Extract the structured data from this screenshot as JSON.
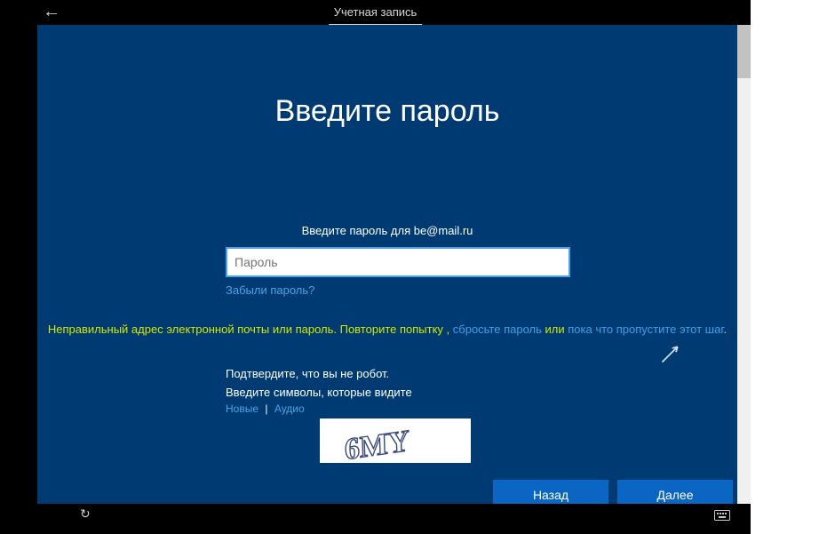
{
  "topbar": {
    "tab_label": "Учетная запись"
  },
  "headline": "Введите пароль",
  "instruction": "Введите пароль для be@mail.ru",
  "password_placeholder": "Пароль",
  "forgot_label": "Забыли пароль?",
  "error": {
    "part1": "Неправильный адрес электронной почты или пароль. Повторите попытку",
    "comma": " , ",
    "reset_link": "сбросьте пароль",
    "or": " или ",
    "skip_link": "пока что пропустите этот шаг",
    "dot": "."
  },
  "captcha": {
    "line1": "Подтвердите, что вы не робот.",
    "line2": "Введите символы, которые видите",
    "new_label": "Новые",
    "audio_label": "Аудио",
    "image_text": "6MY"
  },
  "buttons": {
    "back": "Назад",
    "next": "Далее"
  }
}
